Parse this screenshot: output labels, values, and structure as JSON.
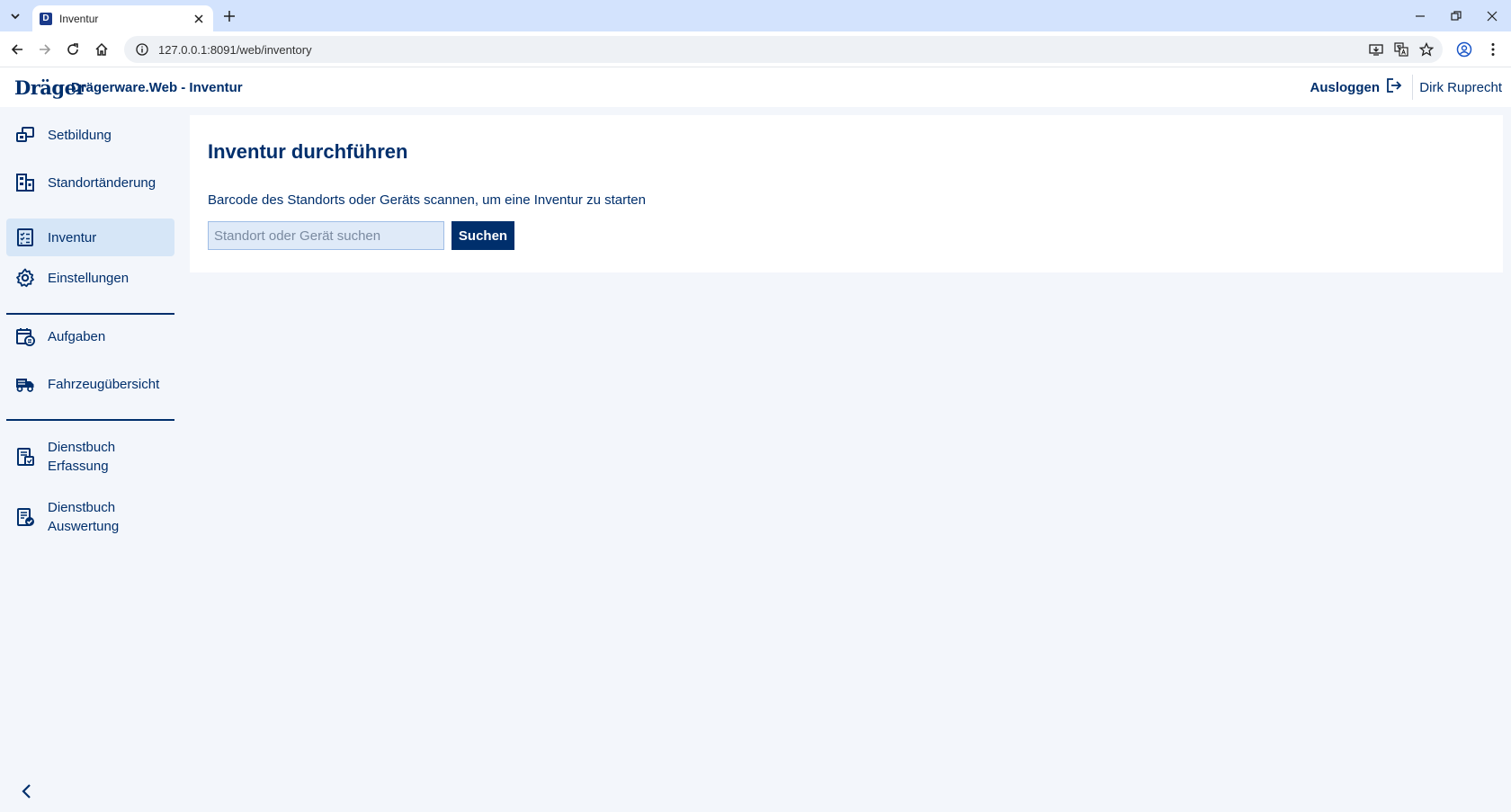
{
  "browser": {
    "tab_title": "Inventur",
    "favicon_letter": "D",
    "url": "127.0.0.1:8091/web/inventory"
  },
  "header": {
    "logo": "Dräger",
    "title": "Drägerware.Web - Inventur",
    "logout_label": "Ausloggen",
    "user_name": "Dirk Ruprecht"
  },
  "sidebar": {
    "items": [
      {
        "label": "Setbildung",
        "icon": "set-icon"
      },
      {
        "label": "Standortänderung",
        "icon": "building-icon"
      },
      {
        "label": "Inventur",
        "icon": "checklist-icon",
        "active": true
      },
      {
        "label": "Einstellungen",
        "icon": "gear-icon"
      },
      {
        "label": "Aufgaben",
        "icon": "calendar-tasks-icon"
      },
      {
        "label": "Fahrzeugübersicht",
        "icon": "truck-icon"
      },
      {
        "label_line1": "Dienstbuch",
        "label_line2": "Erfassung",
        "icon": "logbook-entry-icon"
      },
      {
        "label_line1": "Dienstbuch",
        "label_line2": "Auswertung",
        "icon": "logbook-evaluation-icon"
      }
    ]
  },
  "main": {
    "title": "Inventur durchführen",
    "instruction": "Barcode des Standorts oder Geräts scannen, um eine Inventur zu starten",
    "search_placeholder": "Standort oder Gerät suchen",
    "search_value": "",
    "search_button": "Suchen"
  },
  "colors": {
    "brand": "#002f6c",
    "active_bg": "#d6e6f7",
    "page_bg": "#f3f6fb"
  }
}
